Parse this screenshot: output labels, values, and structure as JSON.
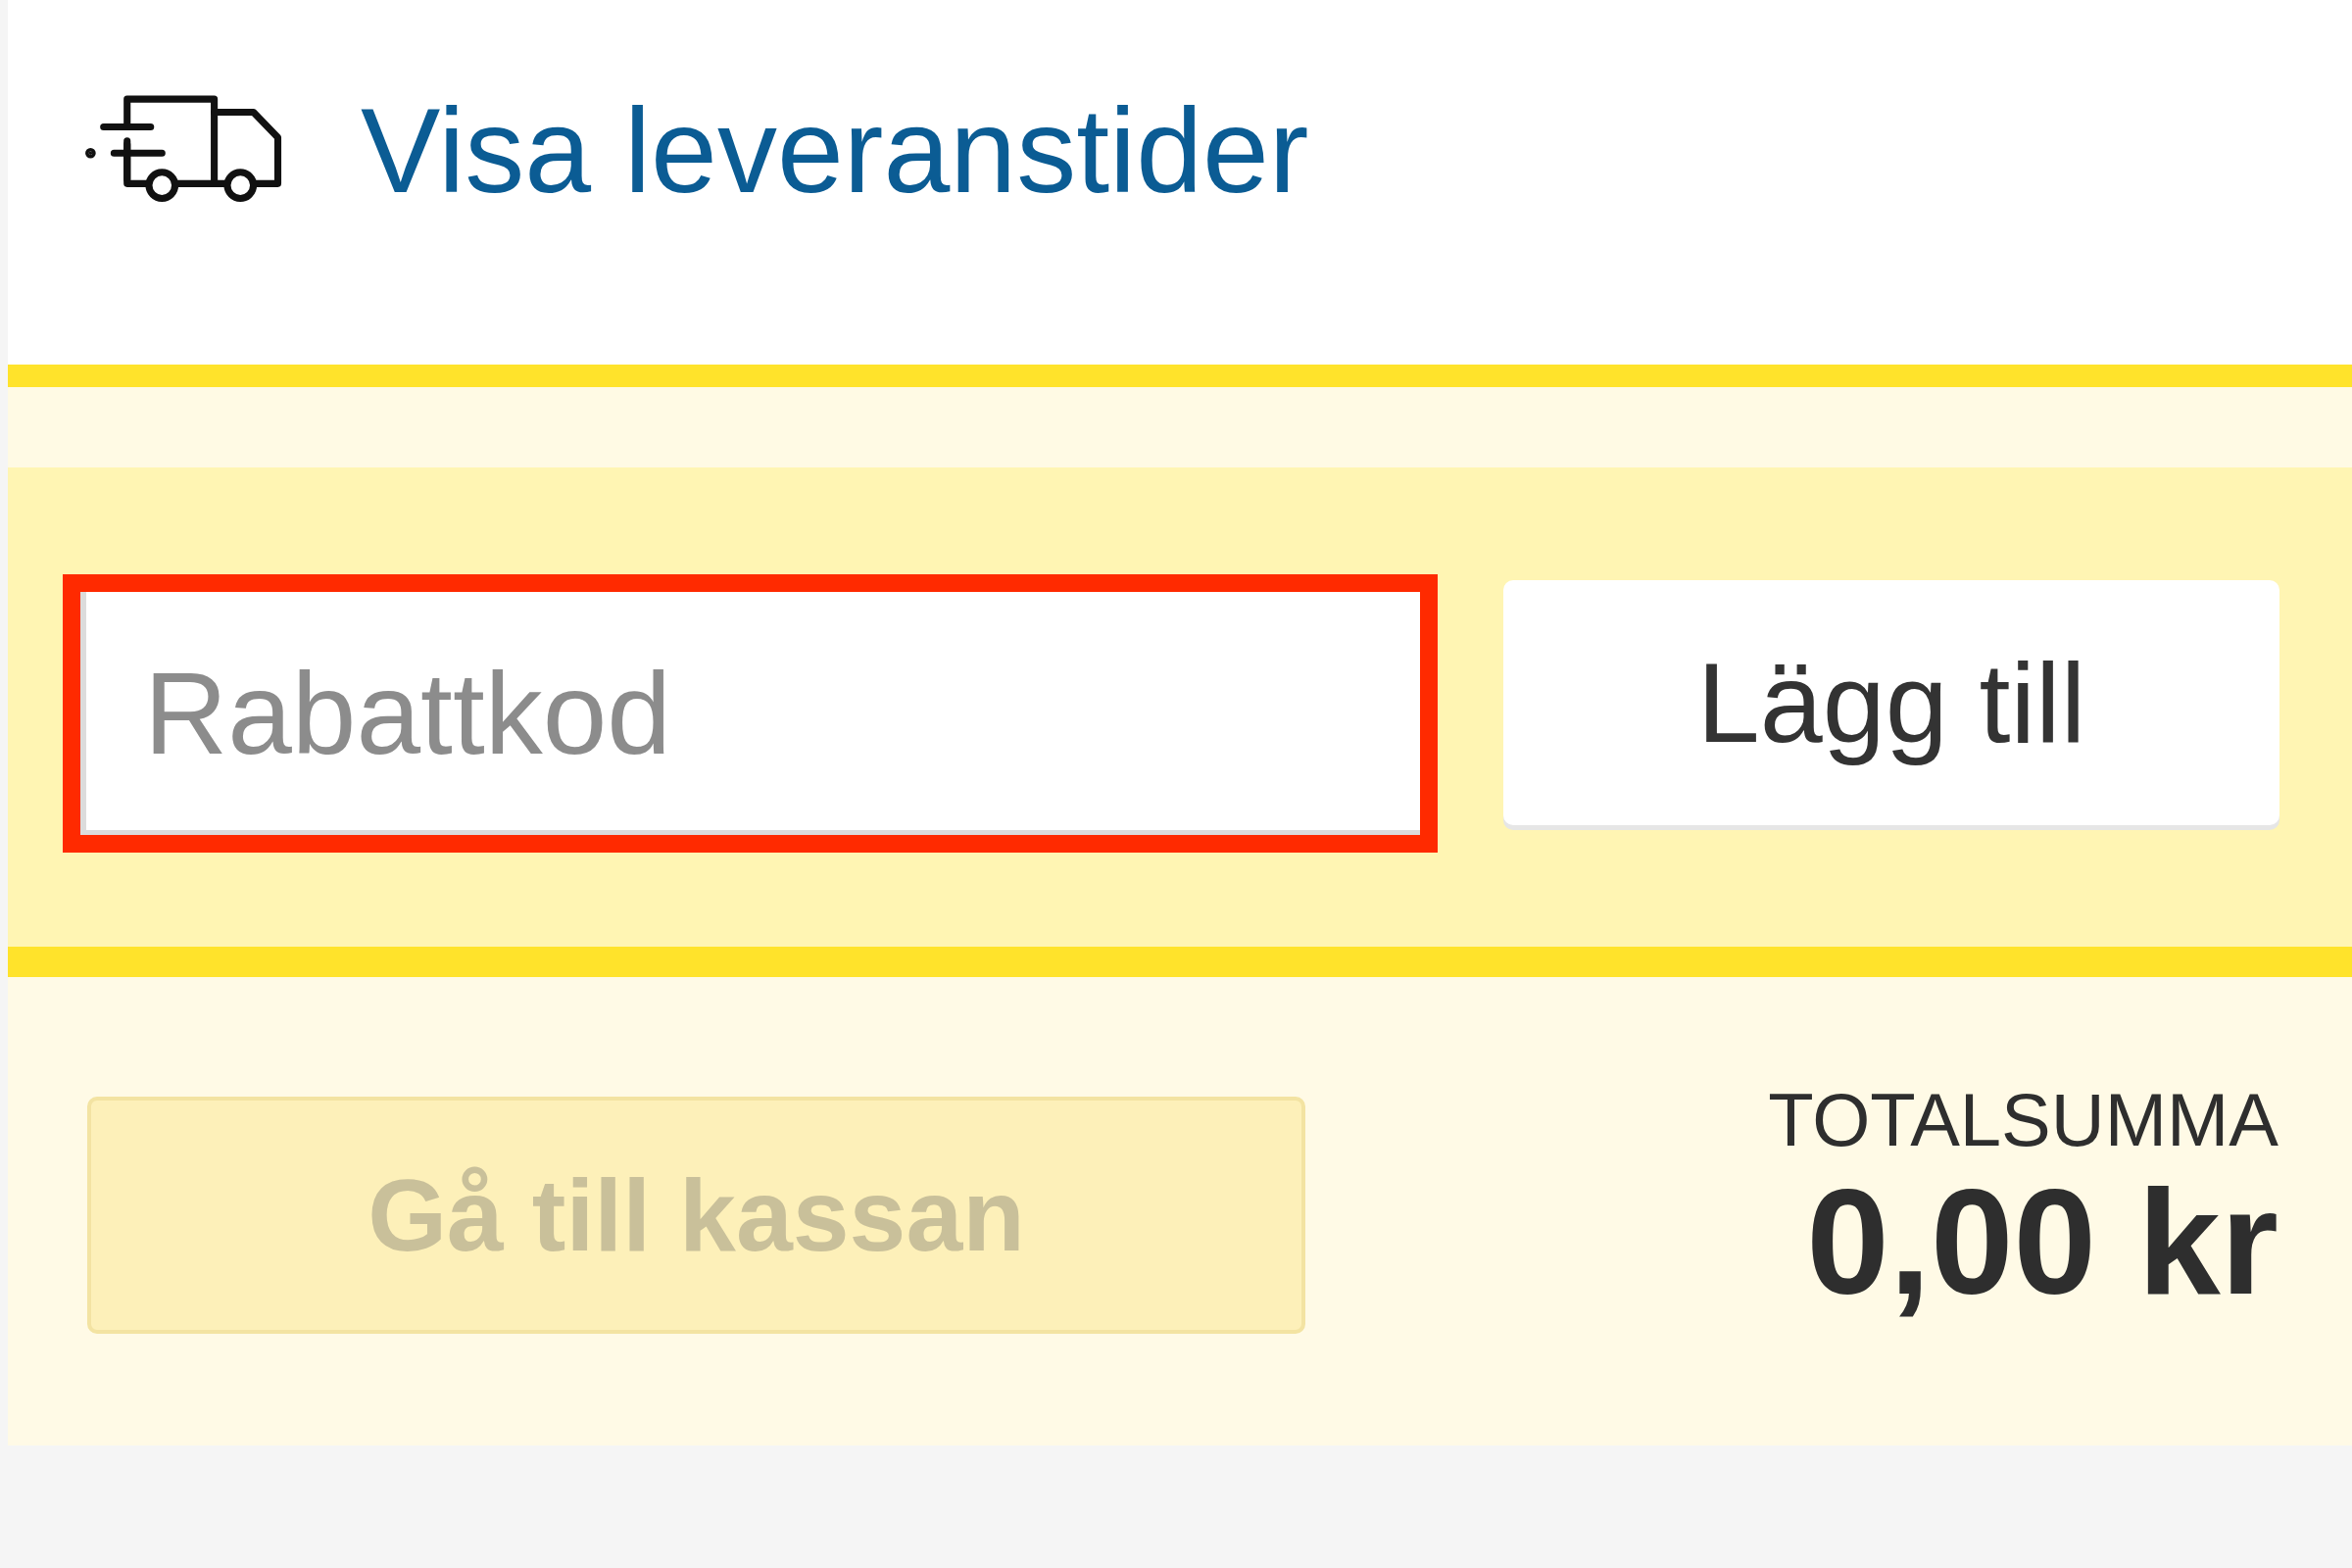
{
  "delivery_link": {
    "label": "Visa leveranstider"
  },
  "discount": {
    "field": {
      "placeholder": "Rabattkod",
      "highlighted": true
    },
    "button": {
      "label": "Lägg till"
    }
  },
  "checkout": {
    "button": {
      "label": "Gå till kassan",
      "disabled": true
    },
    "total": {
      "label": "TOTALSUMMA",
      "value": "0,00 kr"
    }
  }
}
